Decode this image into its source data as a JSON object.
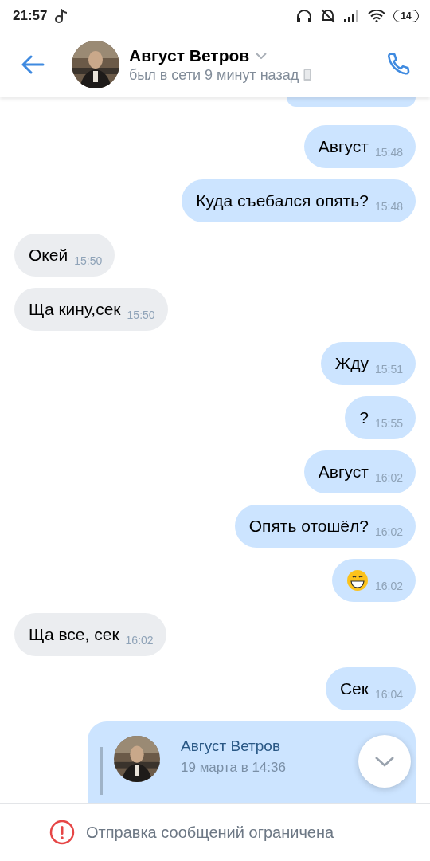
{
  "status_bar": {
    "time": "21:57",
    "battery": "14"
  },
  "header": {
    "name": "Август Ветров",
    "status": "был в сети 9 минут назад"
  },
  "messages": [
    {
      "kind": "cut",
      "outgoing": true
    },
    {
      "kind": "text",
      "outgoing": true,
      "text": "Август",
      "time": "15:48"
    },
    {
      "kind": "text",
      "outgoing": true,
      "text": "Куда съебался опять?",
      "time": "15:48"
    },
    {
      "kind": "text",
      "outgoing": false,
      "text": "Окей",
      "time": "15:50"
    },
    {
      "kind": "text",
      "outgoing": false,
      "text": "Ща кину,сек",
      "time": "15:50"
    },
    {
      "kind": "text",
      "outgoing": true,
      "text": "Жду",
      "time": "15:51"
    },
    {
      "kind": "text",
      "outgoing": true,
      "text": "?",
      "time": "15:55"
    },
    {
      "kind": "text",
      "outgoing": true,
      "text": "Август",
      "time": "16:02"
    },
    {
      "kind": "text",
      "outgoing": true,
      "text": "Опять отошёл?",
      "time": "16:02"
    },
    {
      "kind": "emoji",
      "outgoing": true,
      "time": "16:02"
    },
    {
      "kind": "text",
      "outgoing": false,
      "text": "Ща все, сек",
      "time": "16:02"
    },
    {
      "kind": "text",
      "outgoing": true,
      "text": "Сек",
      "time": "16:04"
    },
    {
      "kind": "forward",
      "outgoing": true,
      "author": "Август Ветров",
      "date": "19 марта в 14:36"
    }
  ],
  "footer": {
    "notice": "Отправка сообщений ограничена"
  }
}
